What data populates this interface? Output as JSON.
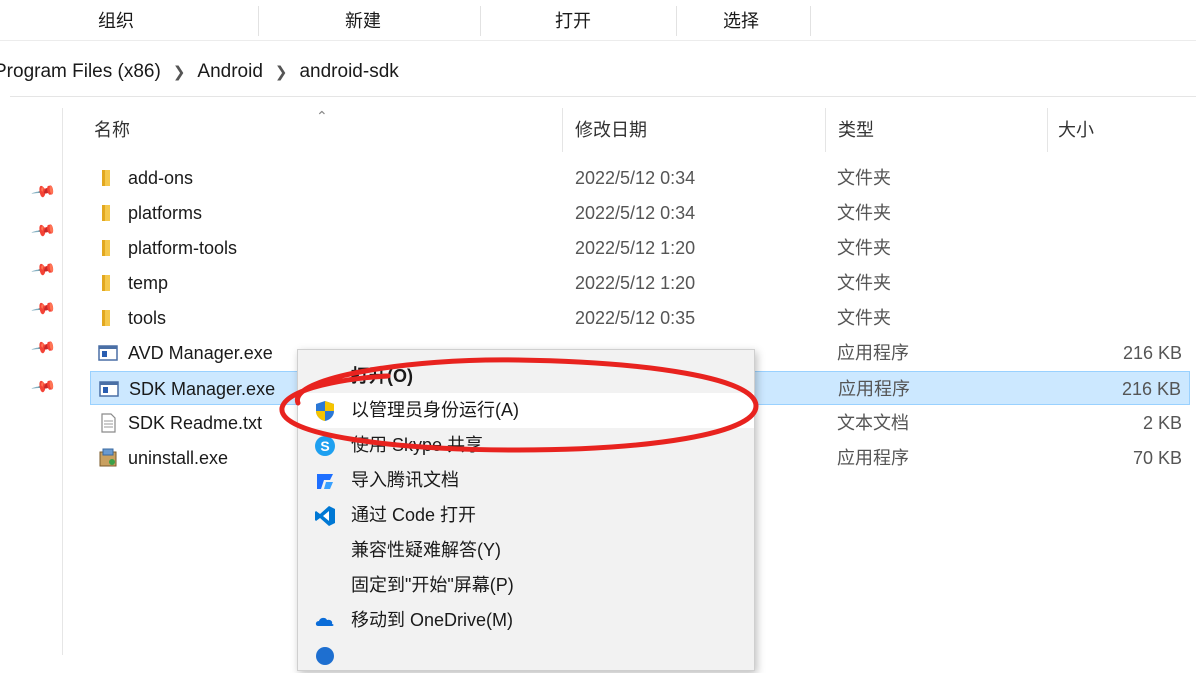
{
  "ribbon": {
    "buttons": [
      "组织",
      "新建",
      "打开",
      "选择"
    ]
  },
  "breadcrumb": [
    "Program Files (x86)",
    "Android",
    "android-sdk"
  ],
  "columns": {
    "name": "名称",
    "date": "修改日期",
    "type": "类型",
    "size": "大小"
  },
  "rows": [
    {
      "name": "add-ons",
      "date": "2022/5/12 0:34",
      "type": "文件夹",
      "size": "",
      "icon": "folder-icon"
    },
    {
      "name": "platforms",
      "date": "2022/5/12 0:34",
      "type": "文件夹",
      "size": "",
      "icon": "folder-icon"
    },
    {
      "name": "platform-tools",
      "date": "2022/5/12 1:20",
      "type": "文件夹",
      "size": "",
      "icon": "folder-icon"
    },
    {
      "name": "temp",
      "date": "2022/5/12 1:20",
      "type": "文件夹",
      "size": "",
      "icon": "folder-icon"
    },
    {
      "name": "tools",
      "date": "2022/5/12 0:35",
      "type": "文件夹",
      "size": "",
      "icon": "folder-icon"
    },
    {
      "name": "AVD Manager.exe",
      "date": "",
      "type": "应用程序",
      "size": "216 KB",
      "icon": "app-window-icon"
    },
    {
      "name": "SDK Manager.exe",
      "date": "",
      "type": "应用程序",
      "size": "216 KB",
      "icon": "app-window-icon",
      "selected": true
    },
    {
      "name": "SDK Readme.txt",
      "date": "",
      "type": "文本文档",
      "size": "2 KB",
      "icon": "text-file-icon"
    },
    {
      "name": "uninstall.exe",
      "date": "",
      "type": "应用程序",
      "size": "70 KB",
      "icon": "installer-icon"
    }
  ],
  "context_menu": {
    "items": [
      {
        "label": "打开(O)",
        "icon": "",
        "bold": true
      },
      {
        "label": "以管理员身份运行(A)",
        "icon": "uac-shield-icon",
        "hover": true
      },
      {
        "label": "使用 Skype 共享",
        "icon": "skype-icon"
      },
      {
        "label": "导入腾讯文档",
        "icon": "tencent-docs-icon"
      },
      {
        "label": "通过 Code 打开",
        "icon": "vscode-icon"
      },
      {
        "label": "兼容性疑难解答(Y)",
        "icon": ""
      },
      {
        "label": "固定到\"开始\"屏幕(P)",
        "icon": ""
      },
      {
        "label": "移动到 OneDrive(M)",
        "icon": "onedrive-icon"
      }
    ]
  },
  "colors": {
    "selection": "#cce8ff",
    "annotation": "#e8231f",
    "folder": "#f5c84c"
  }
}
